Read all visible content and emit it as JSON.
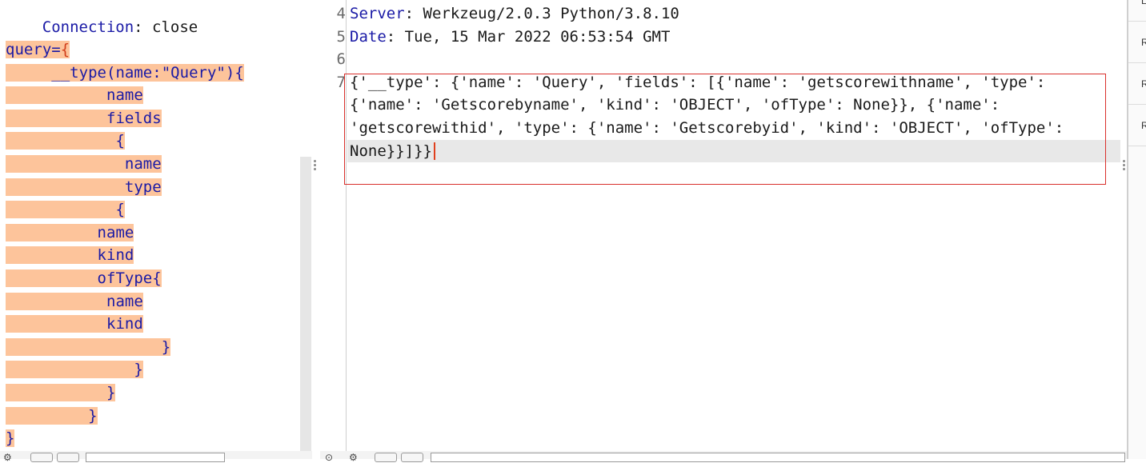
{
  "request": {
    "header_line": {
      "key": "Connection",
      "sep": ": ",
      "value": "close"
    },
    "body_lines": [
      "query={",
      "     __type(name:\"Query\"){",
      "           name",
      "           fields",
      "            {",
      "             name",
      "             type",
      "            {",
      "          name",
      "          kind",
      "          ofType{",
      "           name",
      "           kind",
      "                 }",
      "              }",
      "           }",
      "         }",
      "}"
    ]
  },
  "response": {
    "lines": [
      {
        "num": "4",
        "key": "Server",
        "sep": ": ",
        "value": "Werkzeug/2.0.3 Python/3.8.10"
      },
      {
        "num": "5",
        "key": "Date",
        "sep": ": ",
        "value": "Tue, 15 Mar 2022 06:53:54 GMT"
      },
      {
        "num": "6",
        "key": "",
        "sep": "",
        "value": ""
      },
      {
        "num": "7",
        "key": "",
        "sep": "",
        "value": "{'__type': {'name': 'Query', 'fields': [{'name': 'getscorewithname', 'type':"
      }
    ],
    "wrapped": [
      "{'name': 'Getscorebyname', 'kind': 'OBJECT', 'ofType': None}}, {'name':",
      "'getscorewithid', 'type': {'name': 'Getscorebyid', 'kind': 'OBJECT', 'ofType':",
      "None}}]}}"
    ]
  },
  "side_tabs": [
    "L",
    "R",
    "R",
    "R"
  ],
  "colors": {
    "highlight": "#fdc49b",
    "keyword": "#1a1aa6",
    "selection_border": "#d9302c",
    "caret": "#e0401e"
  }
}
